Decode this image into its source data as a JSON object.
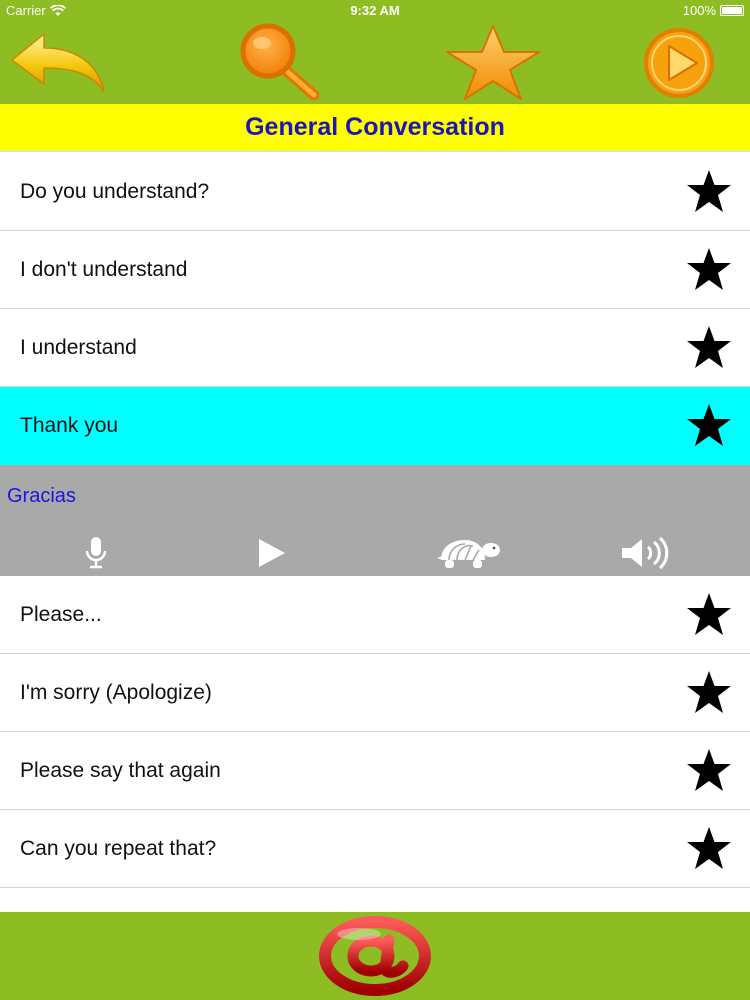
{
  "status_bar": {
    "carrier": "Carrier",
    "time": "9:32 AM",
    "battery": "100%"
  },
  "toolbar": {
    "back_icon": "back-arrow-icon",
    "search_icon": "magnifier-icon",
    "favorites_icon": "star-icon",
    "play_icon": "play-circle-icon"
  },
  "section": {
    "title": "General Conversation"
  },
  "phrases_top": [
    {
      "label": "Do you understand?"
    },
    {
      "label": "I don't understand"
    },
    {
      "label": "I understand"
    },
    {
      "label": "Thank you",
      "selected": true
    }
  ],
  "detail": {
    "translation": "Gracias",
    "controls": [
      "microphone-icon",
      "play-icon",
      "turtle-icon",
      "speaker-icon"
    ]
  },
  "phrases_bottom": [
    {
      "label": "Please..."
    },
    {
      "label": "I'm sorry (Apologize)"
    },
    {
      "label": "Please say that again"
    },
    {
      "label": "Can you repeat that?"
    }
  ],
  "footer": {
    "email_icon": "at-sign-icon"
  },
  "colors": {
    "bar_green": "#8dbd23",
    "header_yellow": "#ffff00",
    "header_text": "#1a16b8",
    "selected_row": "#00ffff",
    "detail_gray": "#a9a9a9",
    "translation_text": "#1a16e0"
  }
}
